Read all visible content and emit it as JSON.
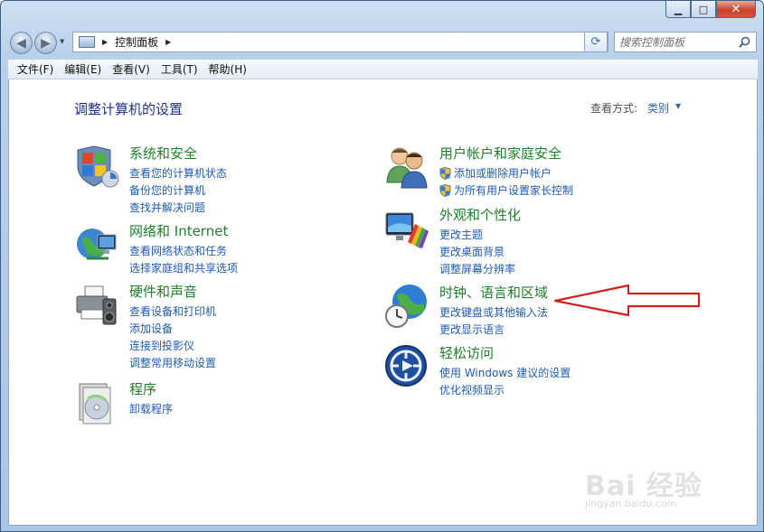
{
  "window": {
    "address_path": "控制面板",
    "search_placeholder": "搜索控制面板",
    "minimize_glyph": "▁",
    "maximize_glyph": "□",
    "close_glyph": "✕"
  },
  "menu": [
    "文件(F)",
    "编辑(E)",
    "查看(V)",
    "工具(T)",
    "帮助(H)"
  ],
  "page": {
    "title": "调整计算机的设置",
    "view_by_label": "查看方式:",
    "view_by_value": "类别"
  },
  "categories": [
    {
      "title": "系统和安全",
      "icon": "shield-flag-icon",
      "links": [
        {
          "text": "查看您的计算机状态",
          "shield": false
        },
        {
          "text": "备份您的计算机",
          "shield": false
        },
        {
          "text": "查找并解决问题",
          "shield": false
        }
      ]
    },
    {
      "title": "网络和 Internet",
      "icon": "network-globe-icon",
      "links": [
        {
          "text": "查看网络状态和任务",
          "shield": false
        },
        {
          "text": "选择家庭组和共享选项",
          "shield": false
        }
      ]
    },
    {
      "title": "硬件和声音",
      "icon": "printer-speaker-icon",
      "links": [
        {
          "text": "查看设备和打印机",
          "shield": false
        },
        {
          "text": "添加设备",
          "shield": false
        },
        {
          "text": "连接到投影仪",
          "shield": false
        },
        {
          "text": "调整常用移动设置",
          "shield": false
        }
      ]
    },
    {
      "title": "程序",
      "icon": "programs-disc-icon",
      "links": [
        {
          "text": "卸载程序",
          "shield": false
        }
      ]
    },
    {
      "title": "用户帐户和家庭安全",
      "icon": "users-icon",
      "links": [
        {
          "text": "添加或删除用户帐户",
          "shield": true
        },
        {
          "text": "为所有用户设置家长控制",
          "shield": true
        }
      ]
    },
    {
      "title": "外观和个性化",
      "icon": "monitor-palette-icon",
      "links": [
        {
          "text": "更改主题",
          "shield": false
        },
        {
          "text": "更改桌面背景",
          "shield": false
        },
        {
          "text": "调整屏幕分辨率",
          "shield": false
        }
      ]
    },
    {
      "title": "时钟、语言和区域",
      "icon": "clock-globe-icon",
      "links": [
        {
          "text": "更改键盘或其他输入法",
          "shield": false
        },
        {
          "text": "更改显示语言",
          "shield": false
        }
      ]
    },
    {
      "title": "轻松访问",
      "icon": "ease-of-access-icon",
      "links": [
        {
          "text": "使用 Windows 建议的设置",
          "shield": false
        },
        {
          "text": "优化视频显示",
          "shield": false
        }
      ]
    }
  ],
  "watermark": {
    "main": "Bai 经验",
    "sub": "jingyan.baidu.com"
  },
  "colors": {
    "category_title": "#1f7f2a",
    "link": "#1f5bb4",
    "page_title": "#1e3287",
    "annotation_arrow": "#d21f1f"
  }
}
